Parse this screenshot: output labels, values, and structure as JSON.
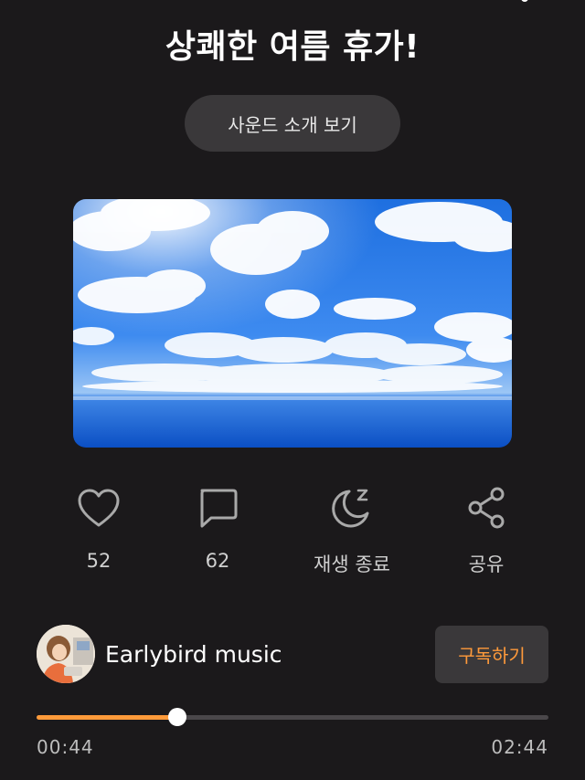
{
  "header": {
    "title": "상쾌한 여름 휴가!"
  },
  "intro_button": {
    "label": "사운드 소개 보기"
  },
  "cover": {
    "icon": "sky-clouds-ocean-image"
  },
  "actions": [
    {
      "icon": "heart-icon",
      "label": "52"
    },
    {
      "icon": "comment-icon",
      "label": "62"
    },
    {
      "icon": "moon-sleep-icon",
      "label": "재생 종료"
    },
    {
      "icon": "share-icon",
      "label": "공유"
    }
  ],
  "channel": {
    "name": "Earlybird music",
    "subscribe_label": "구독하기"
  },
  "player": {
    "current_time": "00:44",
    "total_time": "02:44",
    "progress": 0.275
  },
  "colors": {
    "background": "#1b191b",
    "accent": "#ff9a3a",
    "button_bg": "#3a383a"
  }
}
